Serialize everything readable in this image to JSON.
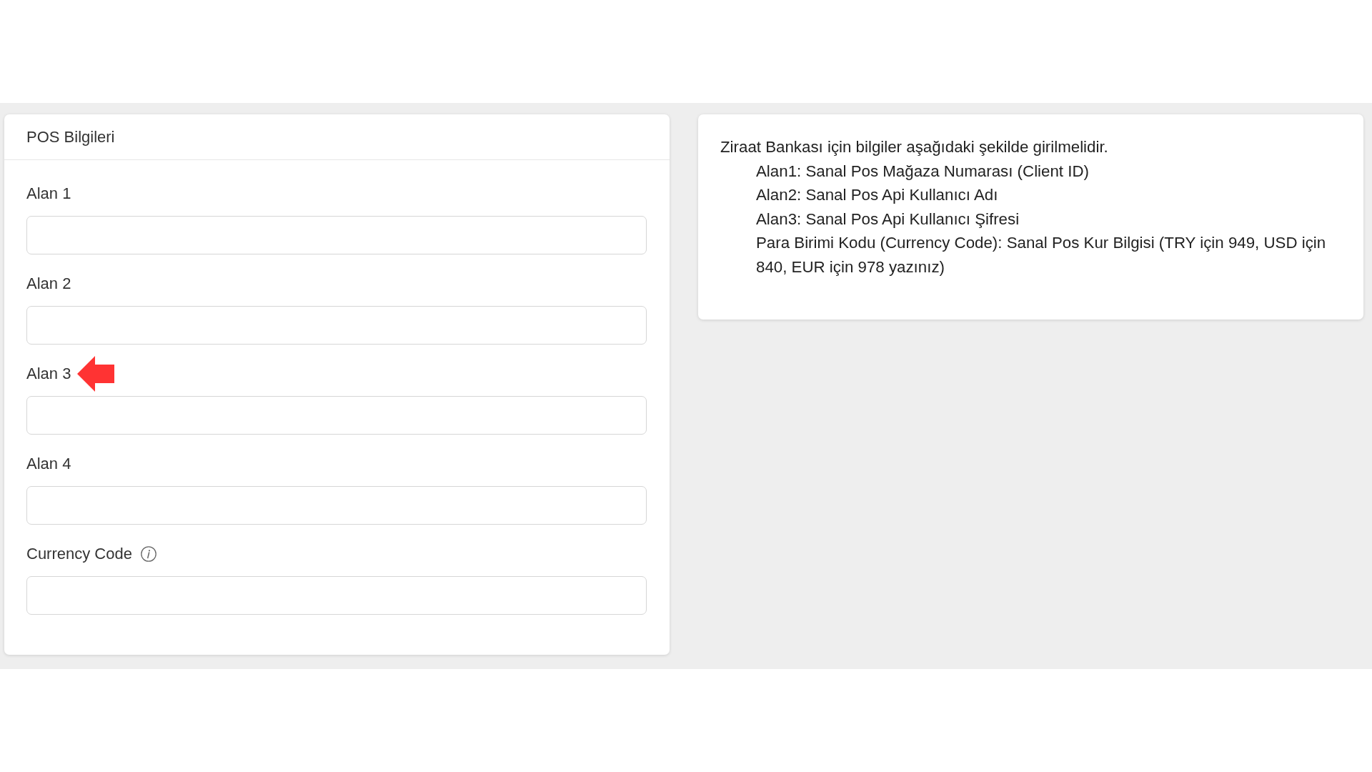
{
  "pos_panel": {
    "title": "POS Bilgileri",
    "fields": [
      {
        "label": "Alan 1",
        "marked": false,
        "info": false
      },
      {
        "label": "Alan 2",
        "marked": false,
        "info": false
      },
      {
        "label": "Alan 3",
        "marked": true,
        "info": false
      },
      {
        "label": "Alan 4",
        "marked": false,
        "info": false
      },
      {
        "label": "Currency Code",
        "marked": false,
        "info": true
      }
    ]
  },
  "info_panel": {
    "intro": "Ziraat Bankası için bilgiler aşağıdaki şekilde girilmelidir.",
    "lines": [
      "Alan1: Sanal Pos Mağaza Numarası (Client ID)",
      "Alan2: Sanal Pos Api Kullanıcı Adı",
      "Alan3: Sanal Pos Api Kullanıcı Şifresi",
      "Para Birimi Kodu (Currency Code): Sanal Pos Kur Bilgisi (TRY için 949, USD için 840, EUR için 978 yazınız)"
    ]
  }
}
